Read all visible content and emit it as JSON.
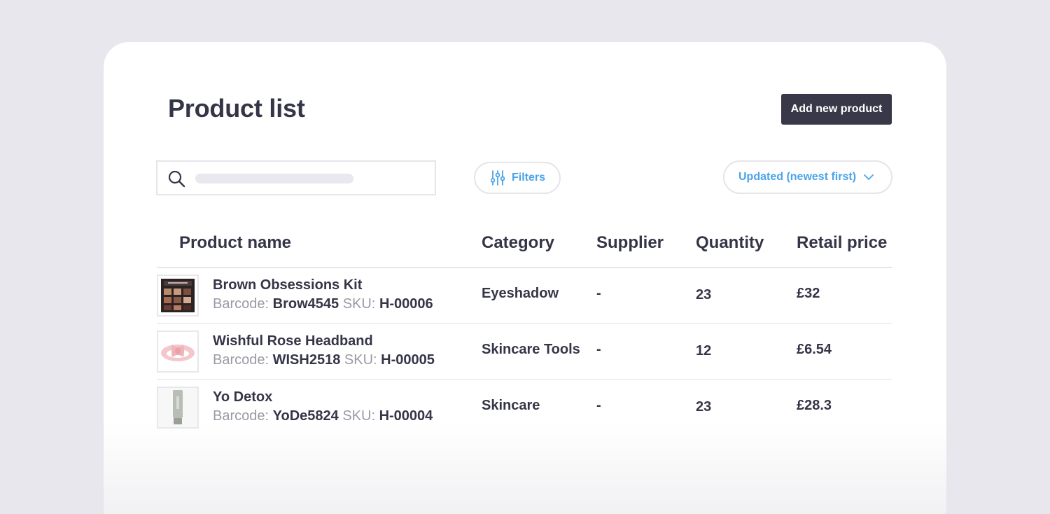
{
  "page": {
    "title": "Product list",
    "add_button_label": "Add new product"
  },
  "toolbar": {
    "search_placeholder": "",
    "filters_label": "Filters",
    "sort_label": "Updated (newest first)"
  },
  "table": {
    "columns": [
      "Product name",
      "Category",
      "Supplier",
      "Quantity",
      "Retail price"
    ],
    "barcode_label": "Barcode:",
    "sku_label": "SKU:",
    "rows": [
      {
        "name": "Brown Obsessions Kit",
        "barcode": "Brow4545",
        "sku": "H-00006",
        "category": "Eyeshadow",
        "supplier": "-",
        "quantity": "23",
        "price": "£32",
        "thumb_icon": "eyeshadow-palette-icon"
      },
      {
        "name": "Wishful Rose Headband",
        "barcode": "WISH2518",
        "sku": "H-00005",
        "category": "Skincare Tools",
        "supplier": "-",
        "quantity": "12",
        "price": "£6.54",
        "thumb_icon": "headband-icon"
      },
      {
        "name": "Yo Detox",
        "barcode": "YoDe5824",
        "sku": "H-00004",
        "category": "Skincare",
        "supplier": "-",
        "quantity": "23",
        "price": "£28.3",
        "thumb_icon": "tube-icon"
      }
    ]
  },
  "colors": {
    "background": "#e7e7ed",
    "primary_button": "#383849",
    "accent": "#4aa3e8",
    "text": "#353548",
    "muted_text": "#9a9aa6"
  }
}
